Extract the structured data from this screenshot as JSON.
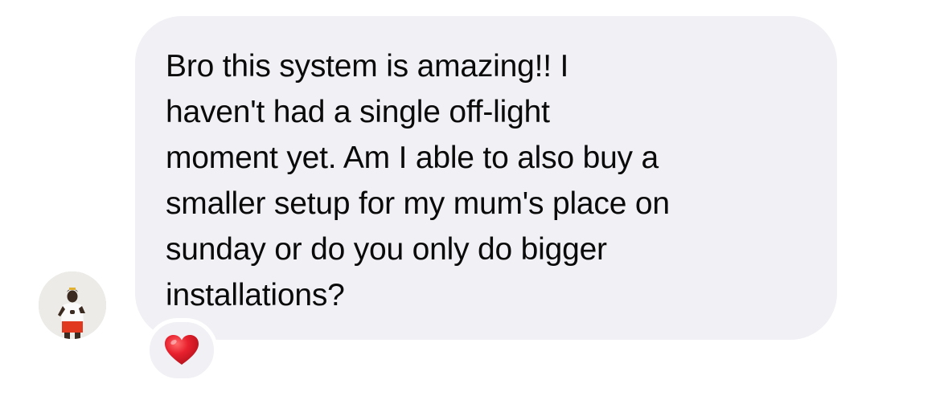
{
  "message": {
    "text": "Bro this system is amazing!! I\nhaven't had a single off-light\nmoment yet. Am I able to also buy a\nsmaller setup for my mum's place on\nsunday or do you only do bigger\ninstallations?",
    "bubble_color": "#f0f0f5",
    "text_color": "#0a0a0a"
  },
  "sender": {
    "avatar_icon": "avatar-photo-icon"
  },
  "reaction": {
    "icon": "heart-icon",
    "color": "#e0202b"
  }
}
